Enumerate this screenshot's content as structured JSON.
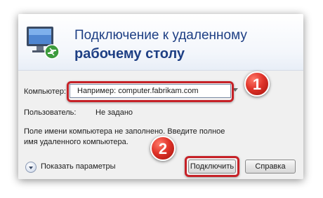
{
  "header": {
    "title_line1": "Подключение к удаленному",
    "title_line2": "рабочему столу",
    "icon": "remote-desktop-icon"
  },
  "form": {
    "computer_label": "Компьютер:",
    "computer_placeholder": "Например: computer.fabrikam.com",
    "user_label": "Пользователь:",
    "user_value": "Не задано",
    "message": "Поле имени компьютера не заполнено. Введите полное имя удаленного компьютера."
  },
  "footer": {
    "show_options_label": "Показать параметры",
    "connect_label": "Подключить",
    "help_label": "Справка"
  },
  "annotations": {
    "step1": "1",
    "step2": "2",
    "highlight_color": "#c62127"
  }
}
